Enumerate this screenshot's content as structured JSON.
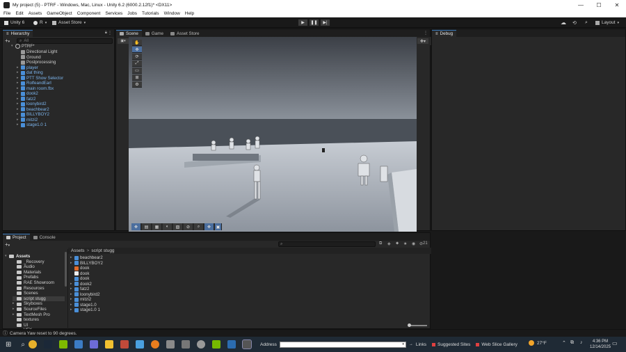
{
  "window": {
    "title": "My project (5) - PTRF - Windows, Mac, Linux - Unity 6.2 (6000.2.12f1)* <DX11>",
    "minimize": "—",
    "maximize": "☐",
    "close": "✕"
  },
  "menu": [
    "File",
    "Edit",
    "Assets",
    "GameObject",
    "Component",
    "Services",
    "Jobs",
    "Tutorials",
    "Window",
    "Help"
  ],
  "toolbar": {
    "account": "Unity 6",
    "collab": "R",
    "asset_store": "Asset Store",
    "layout": "Layout"
  },
  "hierarchy": {
    "tab": "Hierarchy",
    "search_placeholder": "All",
    "scene_name": "PTRF*",
    "items": [
      {
        "label": "Directional Light",
        "type": "gray"
      },
      {
        "label": "Ground",
        "type": "gray"
      },
      {
        "label": "Postprocessing",
        "type": "gray"
      },
      {
        "label": "player",
        "type": "prefab"
      },
      {
        "label": "dat thing",
        "type": "prefab"
      },
      {
        "label": "PTT Show Selector",
        "type": "prefab"
      },
      {
        "label": "RolfeandEarl",
        "type": "prefab"
      },
      {
        "label": "main room.fbx",
        "type": "prefab"
      },
      {
        "label": "dook2",
        "type": "prefab"
      },
      {
        "label": "fatz2",
        "type": "prefab"
      },
      {
        "label": "loonybird2",
        "type": "prefab"
      },
      {
        "label": "beachbear2",
        "type": "prefab"
      },
      {
        "label": "BILLYBOY2",
        "type": "prefab"
      },
      {
        "label": "mitzi2",
        "type": "prefab"
      },
      {
        "label": "stage1.0 1",
        "type": "prefab"
      }
    ]
  },
  "scene_tabs": {
    "scene": "Scene",
    "game": "Game",
    "asset_store": "Asset Store"
  },
  "debug_tab": "Debug",
  "project": {
    "tab_project": "Project",
    "tab_console": "Console",
    "breadcrumb_root": "Assets",
    "breadcrumb_sep": ">",
    "breadcrumb_current": "script stugg",
    "count": "21",
    "folders": [
      "Assets",
      "_Recovery",
      "Audio",
      "Materials",
      "Prefabs",
      "RAE Showroom",
      "Resources",
      "Scenes",
      "script stugg",
      "Skyboxes",
      "SourceFiles",
      "TextMesh Pro",
      "textures",
      "UI",
      "VFX"
    ],
    "files": [
      "beachbear2",
      "BILLYBOY2",
      "dook",
      "dook",
      "dook",
      "dook2",
      "fatz2",
      "loonybird2",
      "mitzi2",
      "stage1.0",
      "stage1.0 1"
    ]
  },
  "status": "Camera Yaw reset to 90 degrees.",
  "taskbar": {
    "address_label": "Address",
    "links": "Links",
    "suggested": "Suggested Sites",
    "gallery": "Web Slice Gallery",
    "weather": "27°F",
    "time": "4:36 PM",
    "date": "12/14/2025"
  }
}
